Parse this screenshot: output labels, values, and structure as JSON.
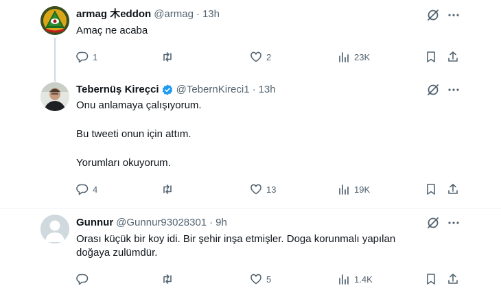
{
  "tweets": [
    {
      "name": "armag 木eddon",
      "handle": "@armag",
      "time": "13h",
      "lines": [
        "Amaç ne acaba"
      ],
      "replies": "1",
      "retweets": "",
      "likes": "2",
      "views": "23K",
      "verified": false
    },
    {
      "name": "Tebernüş Kireçci",
      "handle": "@TebernKireci1",
      "time": "13h",
      "lines": [
        "Onu anlamaya çalışıyorum.",
        "Bu tweeti onun için attım.",
        "Yorumları okuyorum."
      ],
      "replies": "4",
      "retweets": "",
      "likes": "13",
      "views": "19K",
      "verified": true
    },
    {
      "name": "Gunnur",
      "handle": "@Gunnur93028301",
      "time": "9h",
      "lines": [
        "Orası küçük bir koy idi. Bir şehir inşa etmişler. Doga korunmalı yapılan",
        "doğaya zulümdür."
      ],
      "replies": "",
      "retweets": "",
      "likes": "5",
      "views": "1.4K",
      "verified": false
    }
  ],
  "separator": "·",
  "icons": {
    "reply": "reply-icon",
    "retweet": "retweet-icon",
    "like": "like-icon",
    "views": "views-icon",
    "bookmark": "bookmark-icon",
    "share": "share-icon",
    "grok": "grok-icon",
    "more": "more-icon"
  },
  "colors": {
    "text": "#0f1419",
    "secondary": "#536471",
    "verified": "#1d9bf0",
    "divider": "#eff3f4"
  }
}
